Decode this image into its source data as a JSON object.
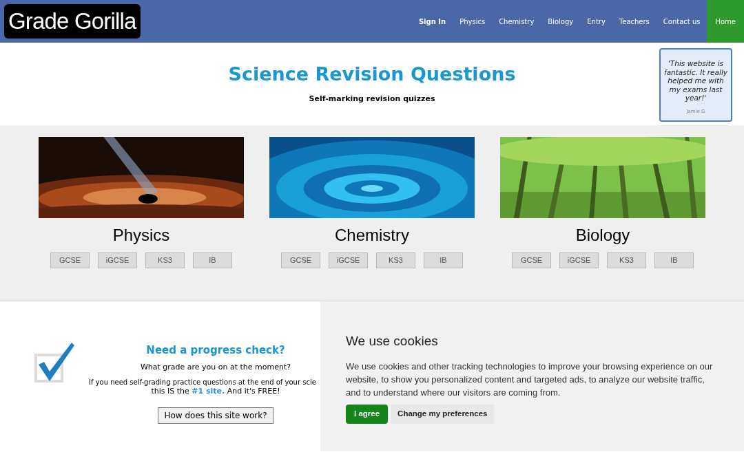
{
  "header": {
    "logo": "Grade Gorilla",
    "nav": [
      {
        "label": "Sign In",
        "kind": "bold",
        "selected": false
      },
      {
        "label": "Physics",
        "kind": "plain",
        "selected": false
      },
      {
        "label": "Chemistry",
        "kind": "plain",
        "selected": false
      },
      {
        "label": "Biology",
        "kind": "plain",
        "selected": false
      },
      {
        "label": "Entry",
        "kind": "plain",
        "selected": false
      },
      {
        "label": "Teachers",
        "kind": "plain",
        "selected": false
      },
      {
        "label": "Contact us",
        "kind": "plain",
        "selected": false
      },
      {
        "label": "Home",
        "kind": "plain",
        "selected": true
      }
    ]
  },
  "hero": {
    "title": "Science Revision Questions",
    "subtitle": "Self-marking revision quizzes"
  },
  "testimonial": {
    "quote": "'This website is fantastic. It really helped me with my exams last year!'",
    "author": "Jamie G"
  },
  "subjects": [
    {
      "name": "Physics",
      "levels": [
        "GCSE",
        "iGCSE",
        "KS3",
        "IB"
      ]
    },
    {
      "name": "Chemistry",
      "levels": [
        "GCSE",
        "iGCSE",
        "KS3",
        "IB"
      ]
    },
    {
      "name": "Biology",
      "levels": [
        "GCSE",
        "iGCSE",
        "KS3",
        "IB"
      ]
    }
  ],
  "progress": {
    "title": "Need a progress check?",
    "question": "What grade are you on at the moment?",
    "line1": "If you need self-grading practice questions at the end of your scie",
    "line2_before": "this IS the",
    "line2_link": "#1 site.",
    "line2_after": "And it's FREE!",
    "button": "How does this site work?"
  },
  "cookies": {
    "title": "We use cookies",
    "text": "We use cookies and other tracking technologies to improve your browsing experience on our website, to show you personalized content and targeted ads, to analyze our website traffic, and to understand where our visitors are coming from.",
    "agree": "I agree",
    "preferences": "Change my preferences"
  }
}
